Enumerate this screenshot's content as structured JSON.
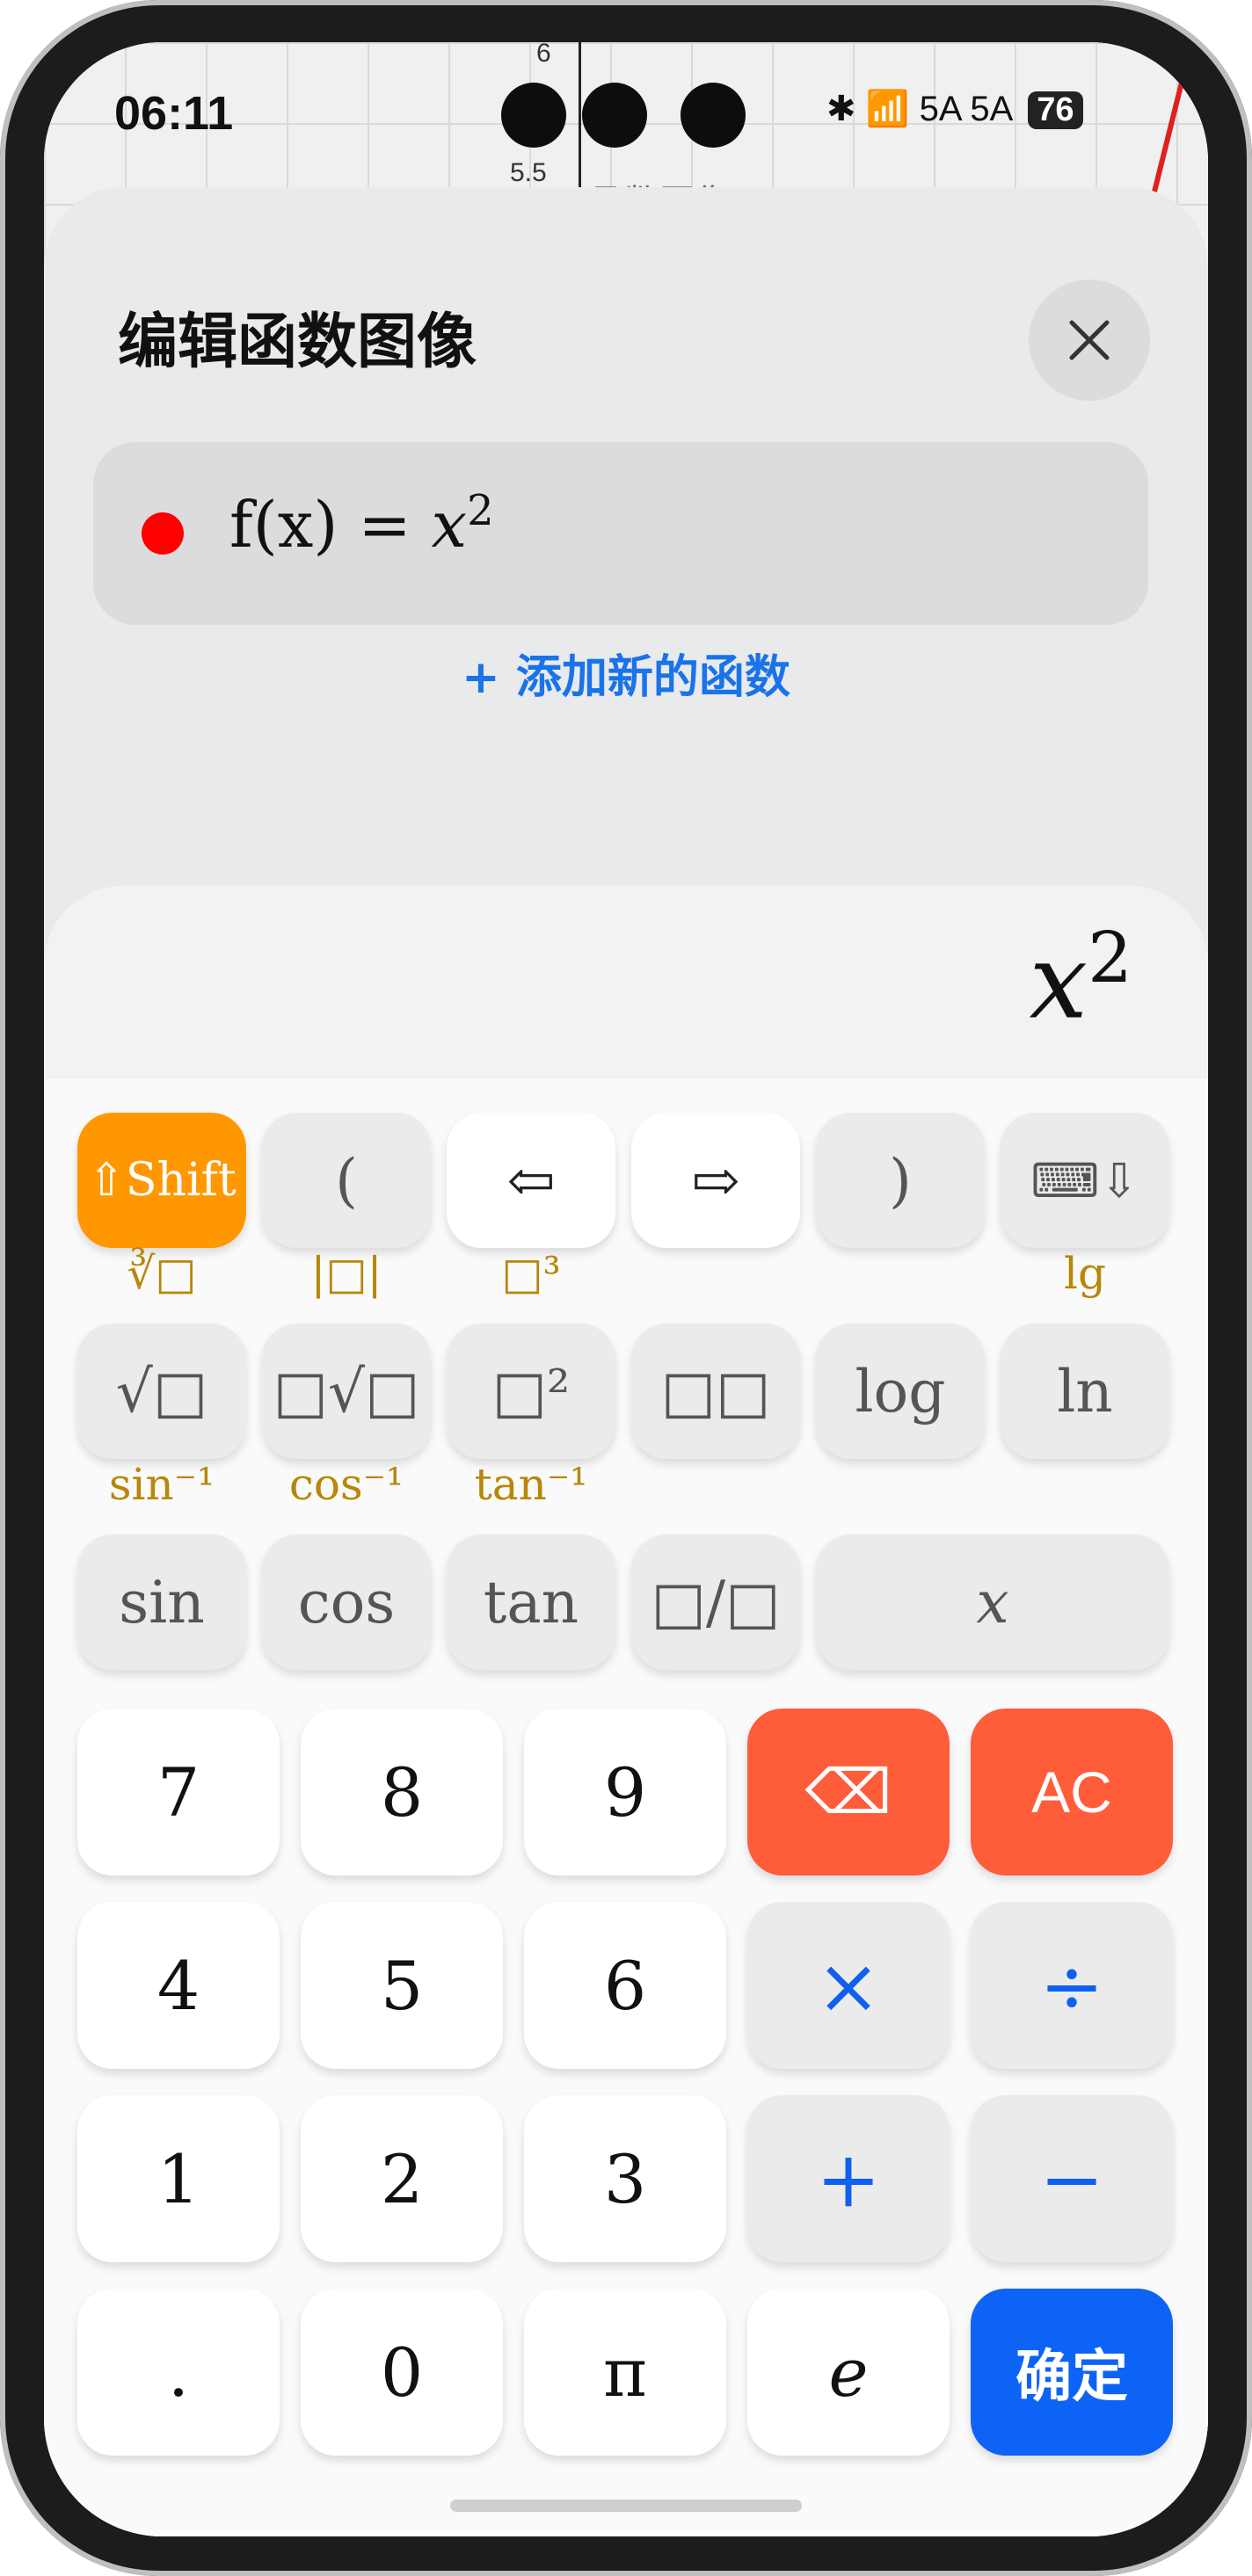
{
  "status_bar": {
    "time": "06:11",
    "network": "5A 5A",
    "battery": "76"
  },
  "background_graph": {
    "ticks": [
      "6",
      "5.5"
    ],
    "title_fragment": "函数图像"
  },
  "sheet": {
    "title": "编辑函数图像",
    "close_icon": "close-icon",
    "function": {
      "color": "#ff0000",
      "label": "f(x) = ",
      "var": "x",
      "exp": "2"
    },
    "add_function": "+ 添加新的函数"
  },
  "keyboard": {
    "preview": {
      "var": "x",
      "exp": "2"
    },
    "row1": [
      "⇧Shift",
      "(",
      "⇦",
      "⇨",
      ")",
      "⌨⇩"
    ],
    "row2": [
      "√□",
      "□√□",
      "□²",
      "□□",
      "log",
      "ln"
    ],
    "row2_shift": [
      "∛□",
      "|□|",
      "□³",
      "",
      "",
      "lg"
    ],
    "row3": [
      "sin",
      "cos",
      "tan",
      "□/□",
      "x"
    ],
    "row3_shift": [
      "sin⁻¹",
      "cos⁻¹",
      "tan⁻¹"
    ],
    "num_rows": [
      [
        "7",
        "8",
        "9",
        "⌫",
        "AC"
      ],
      [
        "4",
        "5",
        "6",
        "×",
        "÷"
      ],
      [
        "1",
        "2",
        "3",
        "+",
        "−"
      ],
      [
        ".",
        "0",
        "π",
        "e",
        "确定"
      ]
    ]
  },
  "colors": {
    "accent_orange": "#ff9800",
    "delete_red": "#ff5c3a",
    "confirm_blue": "#0d63f5",
    "operator_blue": "#1060f0",
    "shift_gold": "#b8860b"
  }
}
